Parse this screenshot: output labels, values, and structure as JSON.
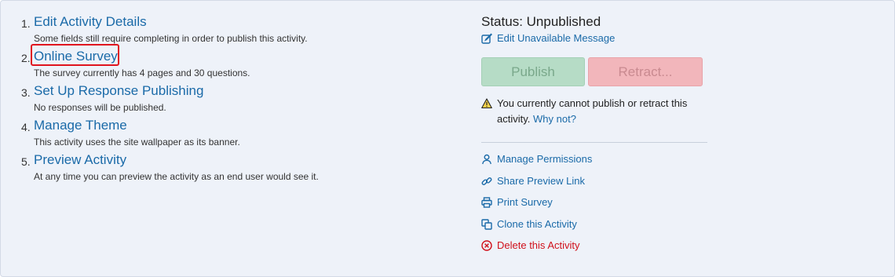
{
  "steps": [
    {
      "num": "1.",
      "title": "Edit Activity Details",
      "desc": "Some fields still require completing in order to publish this activity."
    },
    {
      "num": "2.",
      "title": "Online Survey",
      "desc": "The survey currently has 4 pages and 30 questions."
    },
    {
      "num": "3.",
      "title": "Set Up Response Publishing",
      "desc": "No responses will be published."
    },
    {
      "num": "4.",
      "title": "Manage Theme",
      "desc": "This activity uses the site wallpaper as its banner."
    },
    {
      "num": "5.",
      "title": "Preview Activity",
      "desc": "At any time you can preview the activity as an end user would see it."
    }
  ],
  "status": {
    "text": "Status: Unpublished",
    "edit_message_label": "Edit Unavailable Message"
  },
  "buttons": {
    "publish": "Publish",
    "retract": "Retract..."
  },
  "warning": {
    "text": "You currently cannot publish or retract this activity.",
    "why_label": "Why not?"
  },
  "actions": {
    "manage_permissions": "Manage Permissions",
    "share_preview": "Share Preview Link",
    "print_survey": "Print Survey",
    "clone_activity": "Clone this Activity",
    "delete_activity": "Delete this Activity"
  },
  "colors": {
    "link": "#1a6aa8",
    "danger": "#d0111b",
    "highlight": "#e0141e"
  }
}
